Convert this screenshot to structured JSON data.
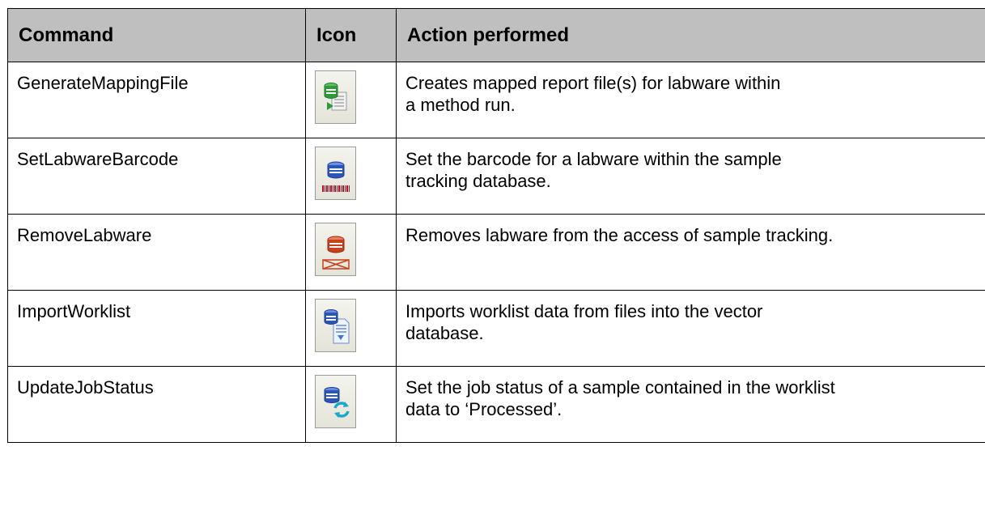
{
  "table": {
    "headers": {
      "command": "Command",
      "icon": "Icon",
      "action": "Action performed"
    },
    "rows": [
      {
        "command": "GenerateMappingFile",
        "icon": "mapping-file-icon",
        "action": "Creates mapped report file(s) for labware within\na method run."
      },
      {
        "command": "SetLabwareBarcode",
        "icon": "labware-barcode-icon",
        "action": "Set the barcode for a labware within the sample\ntracking database."
      },
      {
        "command": "RemoveLabware",
        "icon": "remove-labware-icon",
        "action": "Removes labware from the access of sample tracking."
      },
      {
        "command": "ImportWorklist",
        "icon": "import-worklist-icon",
        "action": "Imports worklist data from files into the vector\ndatabase."
      },
      {
        "command": "UpdateJobStatus",
        "icon": "update-job-status-icon",
        "action": "Set the job status of a sample contained in the worklist\ndata to ‘Processed’."
      }
    ]
  },
  "colors": {
    "header_bg": "#bfbfbf",
    "border": "#000000",
    "db_green": "#2e9a3a",
    "db_blue": "#2a56b8",
    "db_red": "#c8401c",
    "barcode_red": "#b0102a"
  }
}
